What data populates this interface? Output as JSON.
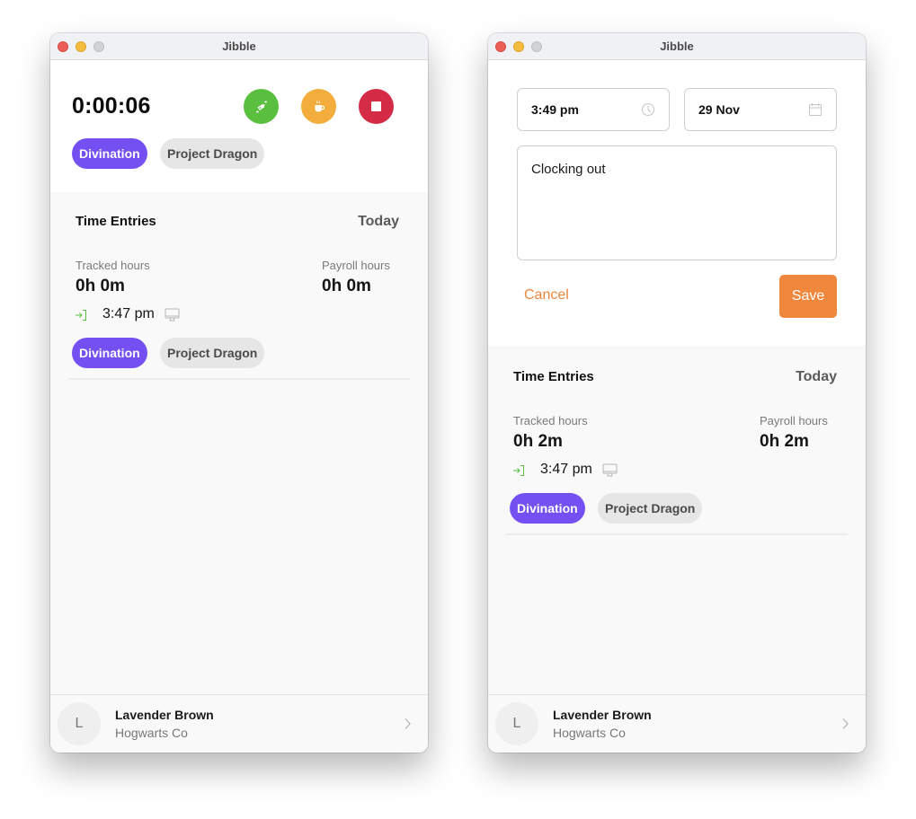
{
  "colors": {
    "activity_chip": "#7450f2",
    "project_chip": "#e6e6e6",
    "switch_button": "#5abf3f",
    "break_button": "#f2ad3d",
    "stop_button": "#d42b47",
    "accent_orange": "#ef873d",
    "clock_in_green": "#5abf3f"
  },
  "windows": [
    {
      "title": "Jibble",
      "timer": "0:00:06",
      "actions": [
        {
          "name": "switch-activity",
          "icon": "tag-swap-icon"
        },
        {
          "name": "take-break",
          "icon": "coffee-cup-icon"
        },
        {
          "name": "clock-out",
          "icon": "stop-icon"
        }
      ],
      "current_activity": "Divination",
      "current_project": "Project Dragon",
      "entries": {
        "title": "Time Entries",
        "period": "Today",
        "tracked_label": "Tracked hours",
        "tracked_value": "0h 0m",
        "payroll_label": "Payroll hours",
        "payroll_value": "0h 0m",
        "entry": {
          "type": "clock-in",
          "time": "3:47 pm",
          "device": "desktop",
          "activity": "Divination",
          "project": "Project Dragon"
        }
      },
      "user": {
        "initial": "L",
        "name": "Lavender Brown",
        "organization": "Hogwarts Co"
      }
    },
    {
      "title": "Jibble",
      "form": {
        "time": "3:49 pm",
        "date": "29 Nov",
        "note": "Clocking out",
        "cancel_label": "Cancel",
        "save_label": "Save"
      },
      "entries": {
        "title": "Time Entries",
        "period": "Today",
        "tracked_label": "Tracked hours",
        "tracked_value": "0h 2m",
        "payroll_label": "Payroll hours",
        "payroll_value": "0h 2m",
        "entry": {
          "type": "clock-in",
          "time": "3:47 pm",
          "device": "desktop",
          "activity": "Divination",
          "project": "Project Dragon"
        }
      },
      "user": {
        "initial": "L",
        "name": "Lavender Brown",
        "organization": "Hogwarts Co"
      }
    }
  ]
}
